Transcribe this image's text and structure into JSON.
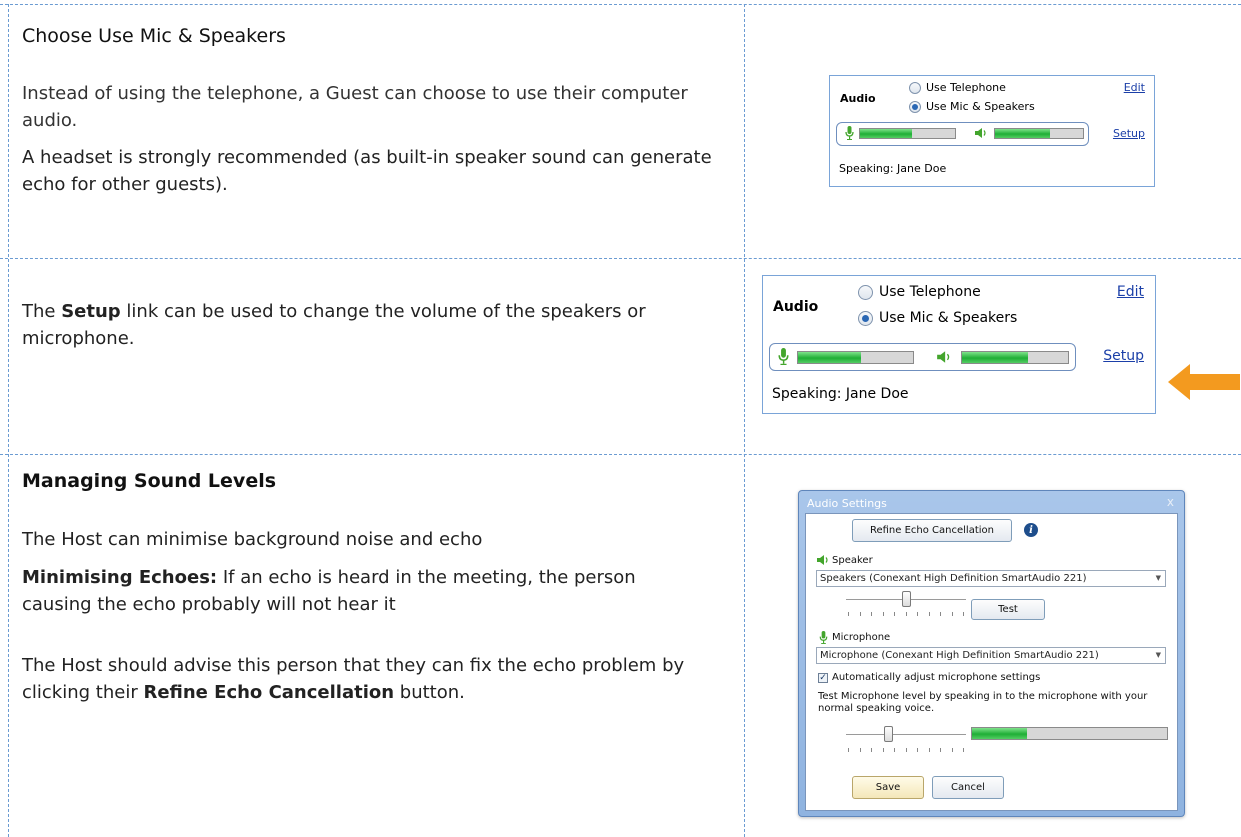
{
  "row1": {
    "heading": "Choose Use Mic & Speakers",
    "para1": "Instead of using the telephone, a Guest can choose to use their computer audio.",
    "para2": "A headset is strongly recommended (as built-in speaker sound can generate echo for other guests)."
  },
  "row2": {
    "para_pre": "The ",
    "para_bold": "Setup",
    "para_post": " link can be used to change the volume of the speakers or microphone."
  },
  "row3": {
    "heading": "Managing Sound Levels",
    "para1": "The Host can minimise background noise and echo",
    "para2_bold": "Minimising Echoes:",
    "para2_rest": " If an echo is heard in the meeting, the person causing the echo probably will not hear it",
    "para3_pre": "The Host should advise this person that they can fix the echo problem by clicking their ",
    "para3_bold": "Refine Echo Cancellation",
    "para3_post": " button."
  },
  "audio_panel": {
    "title": "Audio",
    "option_telephone": "Use Telephone",
    "option_mic": "Use Mic & Speakers",
    "selected": "Use Mic & Speakers",
    "edit_link": "Edit",
    "setup_link": "Setup",
    "speaking": "Speaking: Jane Doe",
    "mic_level": 0.55,
    "speaker_level": 0.62
  },
  "dialog": {
    "title": "Audio Settings",
    "close": "x",
    "refine_button": "Refine Echo Cancellation",
    "speaker_label": "Speaker",
    "speaker_device": "Speakers (Conexant High Definition SmartAudio 221)",
    "test_button": "Test",
    "speaker_slider": 0.5,
    "microphone_label": "Microphone",
    "mic_device": "Microphone (Conexant High Definition SmartAudio 221)",
    "auto_adjust_label": "Automatically adjust microphone settings",
    "auto_adjust_checked": true,
    "instructions": "Test Microphone level by speaking in to the microphone with your normal speaking voice.",
    "mic_slider": 0.35,
    "mic_test_level": 0.28,
    "save_button": "Save",
    "cancel_button": "Cancel"
  },
  "colors": {
    "grid_border": "#6b9bd2",
    "accent_arrow": "#f39a1f",
    "meter_green": "#1fae36"
  }
}
